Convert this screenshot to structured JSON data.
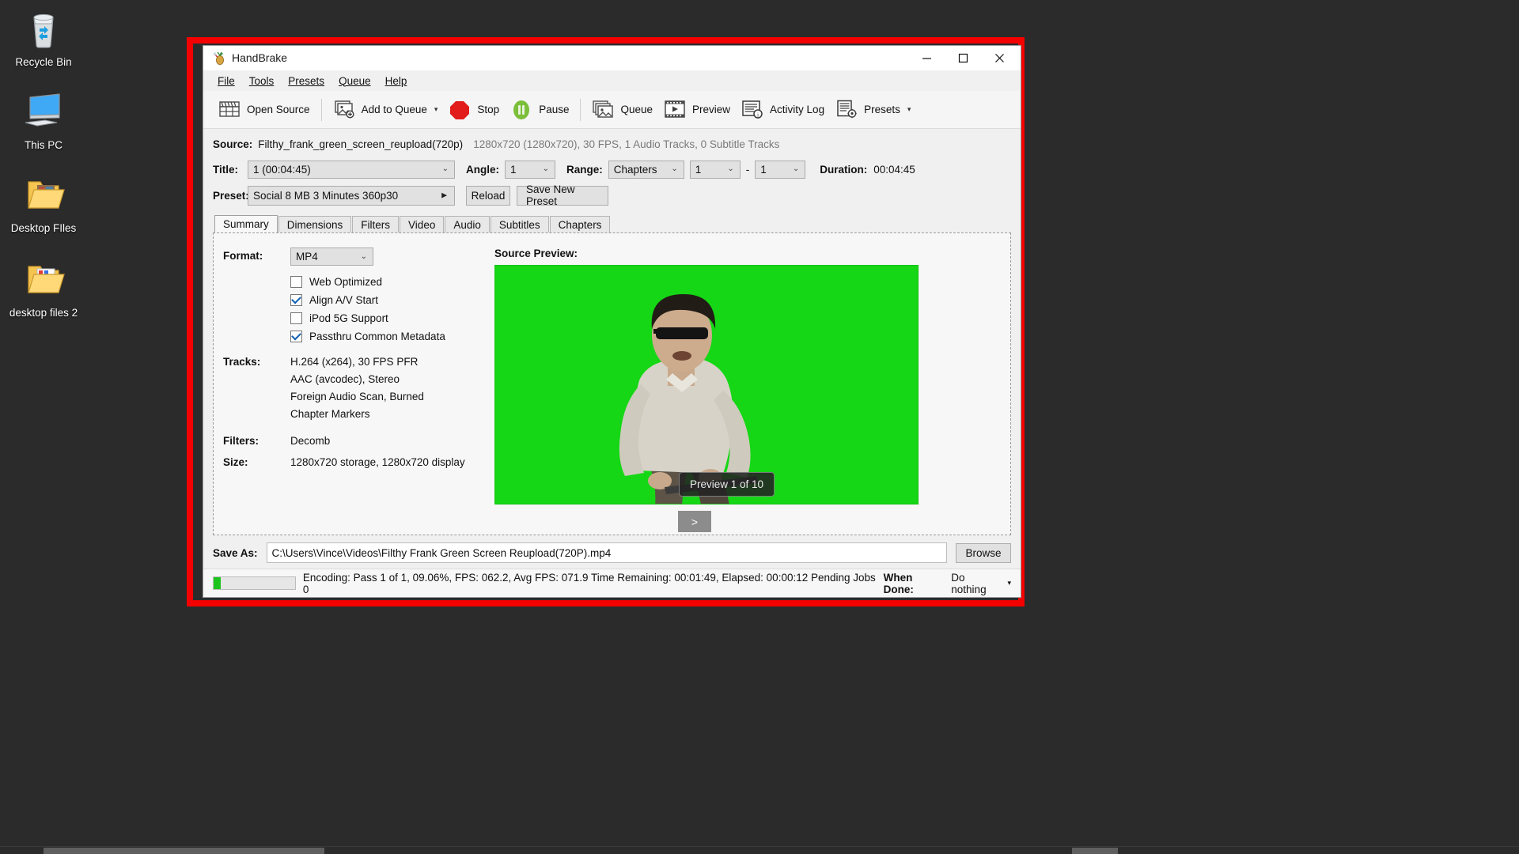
{
  "desktop": {
    "icons": [
      {
        "name": "recycle-bin",
        "label": "Recycle Bin"
      },
      {
        "name": "this-pc",
        "label": "This PC"
      },
      {
        "name": "desktop-files",
        "label": "Desktop FIles"
      },
      {
        "name": "desktop-files-2",
        "label": "desktop files 2"
      }
    ],
    "background_color": "#2b2b2b"
  },
  "highlight": {
    "color": "#f40000"
  },
  "window": {
    "title": "HandBrake",
    "minimize_label": "Minimize",
    "maximize_label": "Maximize",
    "close_label": "Close"
  },
  "menu": {
    "items": [
      {
        "label": "File",
        "mnemonic": "F"
      },
      {
        "label": "Tools",
        "mnemonic": "T"
      },
      {
        "label": "Presets",
        "mnemonic": "P"
      },
      {
        "label": "Queue",
        "mnemonic": "Q"
      },
      {
        "label": "Help",
        "mnemonic": "H"
      }
    ]
  },
  "toolbar": {
    "open_source": "Open Source",
    "add_to_queue": "Add to Queue",
    "stop": "Stop",
    "pause": "Pause",
    "queue": "Queue",
    "preview": "Preview",
    "activity_log": "Activity Log",
    "presets": "Presets",
    "caret": "▾"
  },
  "source": {
    "label": "Source:",
    "name": "Filthy_frank_green_screen_reupload(720p)",
    "meta": "1280x720 (1280x720), 30 FPS, 1 Audio Tracks, 0 Subtitle Tracks"
  },
  "title_row": {
    "title_label": "Title:",
    "title_value": "1  (00:04:45)",
    "angle_label": "Angle:",
    "angle_value": "1",
    "range_label": "Range:",
    "range_value": "Chapters",
    "range_start": "1",
    "range_dash": "-",
    "range_end": "1",
    "duration_label": "Duration:",
    "duration_value": "00:04:45"
  },
  "preset_row": {
    "label": "Preset:",
    "value": "Social 8 MB 3 Minutes 360p30",
    "reload": "Reload",
    "save_new_preset": "Save New Preset"
  },
  "tabs": [
    {
      "label": "Summary",
      "active": true
    },
    {
      "label": "Dimensions",
      "active": false
    },
    {
      "label": "Filters",
      "active": false
    },
    {
      "label": "Video",
      "active": false
    },
    {
      "label": "Audio",
      "active": false
    },
    {
      "label": "Subtitles",
      "active": false
    },
    {
      "label": "Chapters",
      "active": false
    }
  ],
  "summary": {
    "format_label": "Format:",
    "format_value": "MP4",
    "checkboxes": [
      {
        "label": "Web Optimized",
        "checked": false
      },
      {
        "label": "Align A/V Start",
        "checked": true
      },
      {
        "label": "iPod 5G Support",
        "checked": false
      },
      {
        "label": "Passthru Common Metadata",
        "checked": true
      }
    ],
    "tracks_label": "Tracks:",
    "tracks": [
      "H.264 (x264), 30 FPS PFR",
      "AAC (avcodec), Stereo",
      "Foreign Audio Scan, Burned",
      "Chapter Markers"
    ],
    "filters_label": "Filters:",
    "filters_value": "Decomb",
    "size_label": "Size:",
    "size_value": "1280x720 storage, 1280x720 display"
  },
  "preview": {
    "title": "Source Preview:",
    "badge": "Preview 1 of 10",
    "next_label": ">",
    "background_color": "#15d715"
  },
  "save_as": {
    "label": "Save As:",
    "value": "C:\\Users\\Vince\\Videos\\Filthy Frank Green Screen Reupload(720P).mp4",
    "browse": "Browse"
  },
  "status": {
    "progress_percent": 9.06,
    "text": "Encoding: Pass 1 of 1,  09.06%, FPS: 062.2,  Avg FPS: 071.9 Time Remaining: 00:01:49,  Elapsed: 00:00:12    Pending Jobs 0",
    "when_done_label": "When Done:",
    "when_done_value": "Do nothing",
    "when_done_caret": "▾",
    "progress_color": "#1ec41e"
  }
}
